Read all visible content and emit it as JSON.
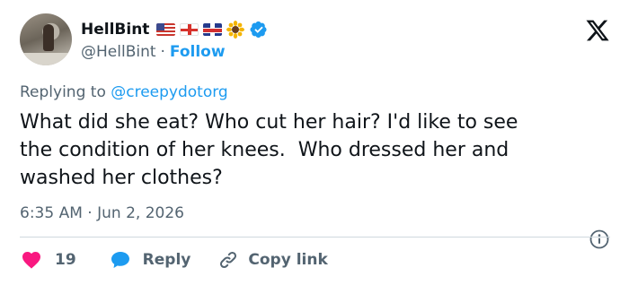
{
  "author": {
    "display_name": "HellBint",
    "handle": "@HellBint",
    "separator": "·",
    "follow_label": "Follow",
    "badges": [
      "us-flag-icon",
      "england-flag-icon",
      "uk-flag-icon",
      "sunflower-icon",
      "verified-badge-icon"
    ]
  },
  "reply": {
    "prefix": "Replying to ",
    "mention": "@creepydotorg"
  },
  "tweet": {
    "text": "What did she eat? Who cut her hair? I'd like to see\nthe condition of her knees.  Who dressed her and\nwashed her clothes?"
  },
  "meta": {
    "time": "6:35 AM",
    "separator": " · ",
    "date": "Jun 2, 2026"
  },
  "actions": {
    "like_count": "19",
    "reply_label": "Reply",
    "copy_link_label": "Copy link"
  },
  "colors": {
    "accent": "#1d9bf0",
    "like": "#f91880",
    "secondary_text": "#536471",
    "divider": "#cfd9de"
  }
}
